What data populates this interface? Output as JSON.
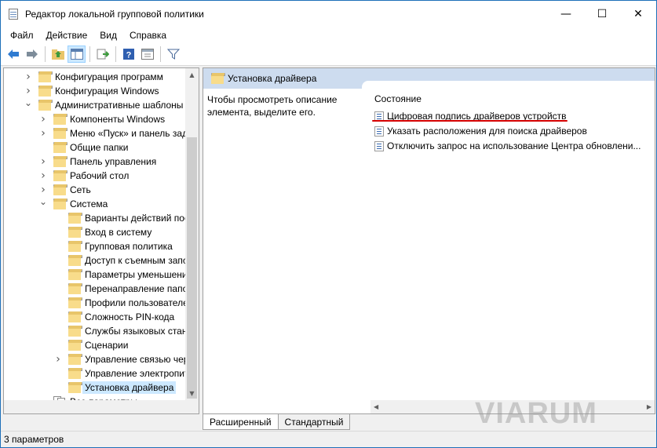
{
  "window": {
    "title": "Редактор локальной групповой политики",
    "controls": {
      "minimize": "—",
      "maximize": "☐",
      "close": "✕"
    }
  },
  "menu": [
    "Файл",
    "Действие",
    "Вид",
    "Справка"
  ],
  "toolbar": {
    "buttons": [
      "back-icon",
      "forward-icon",
      "up-folder-icon",
      "show-hide-tree-icon",
      "export-list-icon",
      "help-icon",
      "properties-icon",
      "filter-icon"
    ]
  },
  "tree": {
    "items": [
      {
        "label": "Конфигурация программ",
        "level": 1,
        "expander": "collapsed"
      },
      {
        "label": "Конфигурация Windows",
        "level": 1,
        "expander": "collapsed"
      },
      {
        "label": "Административные шаблоны",
        "level": 1,
        "expander": "expanded"
      },
      {
        "label": "Компоненты Windows",
        "level": 2,
        "expander": "collapsed"
      },
      {
        "label": "Меню «Пуск» и панель зад",
        "level": 2,
        "expander": "collapsed"
      },
      {
        "label": "Общие папки",
        "level": 2,
        "expander": "none"
      },
      {
        "label": "Панель управления",
        "level": 2,
        "expander": "collapsed"
      },
      {
        "label": "Рабочий стол",
        "level": 2,
        "expander": "collapsed"
      },
      {
        "label": "Сеть",
        "level": 2,
        "expander": "collapsed"
      },
      {
        "label": "Система",
        "level": 2,
        "expander": "expanded"
      },
      {
        "label": "Варианты действий пос",
        "level": 3,
        "expander": "none"
      },
      {
        "label": "Вход в систему",
        "level": 3,
        "expander": "none"
      },
      {
        "label": "Групповая политика",
        "level": 3,
        "expander": "none"
      },
      {
        "label": "Доступ к съемным запс",
        "level": 3,
        "expander": "none"
      },
      {
        "label": "Параметры уменьшени",
        "level": 3,
        "expander": "none"
      },
      {
        "label": "Перенаправление папо",
        "level": 3,
        "expander": "none"
      },
      {
        "label": "Профили пользователе",
        "level": 3,
        "expander": "none"
      },
      {
        "label": "Сложность PIN-кода",
        "level": 3,
        "expander": "none"
      },
      {
        "label": "Службы языковых стан",
        "level": 3,
        "expander": "none"
      },
      {
        "label": "Сценарии",
        "level": 3,
        "expander": "none"
      },
      {
        "label": "Управление связью чер",
        "level": 3,
        "expander": "collapsed"
      },
      {
        "label": "Управление электропит",
        "level": 3,
        "expander": "none"
      },
      {
        "label": "Установка драйвера",
        "level": 3,
        "expander": "none",
        "selected": true
      },
      {
        "label": "Все параметры",
        "level": 2,
        "expander": "none",
        "icon": "documents-icon"
      }
    ]
  },
  "right_pane": {
    "header": "Установка драйвера",
    "description": "Чтобы просмотреть описание элемента, выделите его.",
    "column_header": "Состояние",
    "settings": [
      "Цифровая подпись драйверов устройств",
      "Указать расположения для поиска драйверов",
      "Отключить запрос на использование Центра обновлени..."
    ],
    "highlight_color": "#d40000"
  },
  "tabs": [
    "Расширенный",
    "Стандартный"
  ],
  "status": "3 параметров",
  "watermark": "VIARUM"
}
